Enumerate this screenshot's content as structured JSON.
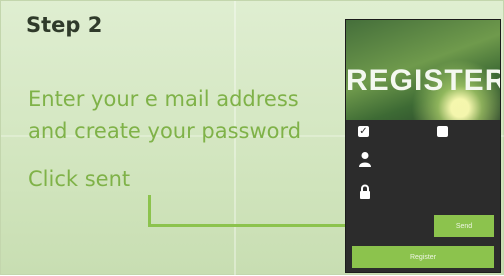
{
  "step": {
    "title": "Step 2",
    "lines": [
      "Enter your e mail address",
      "and  create your password",
      "Click sent"
    ]
  },
  "phone": {
    "title": "REGISTER",
    "send_label": "Send",
    "register_label": "Register",
    "icons": [
      "checkbox-checked",
      "checkbox",
      "user-icon",
      "lock-icon"
    ]
  },
  "colors": {
    "background": "#d8e9c7",
    "instruction_text": "#7fb248",
    "title_text": "#2f3a2a",
    "button_green": "#8cc34d",
    "phone_dark": "#2c2c2c"
  }
}
